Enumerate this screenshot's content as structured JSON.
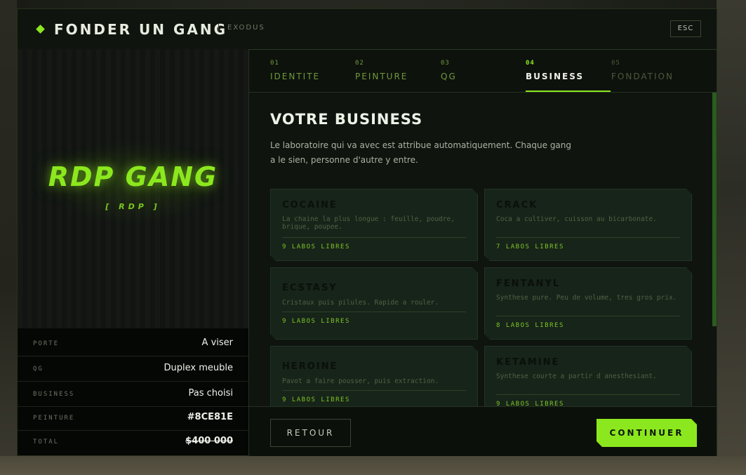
{
  "header": {
    "title": "FONDER UN GANG",
    "subtitle": "EXODUS",
    "esc_label": "ESC"
  },
  "preview": {
    "gang_name": "RDP GANG",
    "gang_tag": "[ RDP ]"
  },
  "summary": [
    {
      "label": "PORTE",
      "value": "A viser"
    },
    {
      "label": "QG",
      "value": "Duplex meuble"
    },
    {
      "label": "BUSINESS",
      "value": "Pas choisi"
    },
    {
      "label": "PEINTURE",
      "value": "#8CE81E"
    },
    {
      "label": "TOTAL",
      "value": "$400 000"
    }
  ],
  "tabs": [
    {
      "num": "01",
      "label": "IDENTITE"
    },
    {
      "num": "02",
      "label": "PEINTURE"
    },
    {
      "num": "03",
      "label": "QG"
    },
    {
      "num": "04",
      "label": "BUSINESS"
    },
    {
      "num": "05",
      "label": "FONDATION"
    }
  ],
  "main": {
    "heading": "VOTRE BUSINESS",
    "description": "Le laboratoire qui va avec est attribue automatiquement. Chaque gang a le sien, personne d'autre y entre."
  },
  "businesses": [
    {
      "name": "COCAINE",
      "desc": "La chaine la plus longue : feuille, poudre, brique, poupee.",
      "labs": "9 LABOS LIBRES"
    },
    {
      "name": "CRACK",
      "desc": "Coca a cultiver, cuisson au bicarbonate.",
      "labs": "7 LABOS LIBRES"
    },
    {
      "name": "ECSTASY",
      "desc": "Cristaux puis pilules. Rapide a rouler.",
      "labs": "9 LABOS LIBRES"
    },
    {
      "name": "FENTANYL",
      "desc": "Synthese pure. Peu de volume, tres gros prix.",
      "labs": "8 LABOS LIBRES"
    },
    {
      "name": "HEROINE",
      "desc": "Pavot a faire pousser, puis extraction.",
      "labs": "9 LABOS LIBRES"
    },
    {
      "name": "KETAMINE",
      "desc": "Synthese courte a partir d anesthesiant.",
      "labs": "9 LABOS LIBRES"
    }
  ],
  "footer": {
    "back_label": "RETOUR",
    "next_label": "CONTINUER"
  },
  "colors": {
    "accent": "#8CE81E",
    "panel": "#0e120d"
  }
}
